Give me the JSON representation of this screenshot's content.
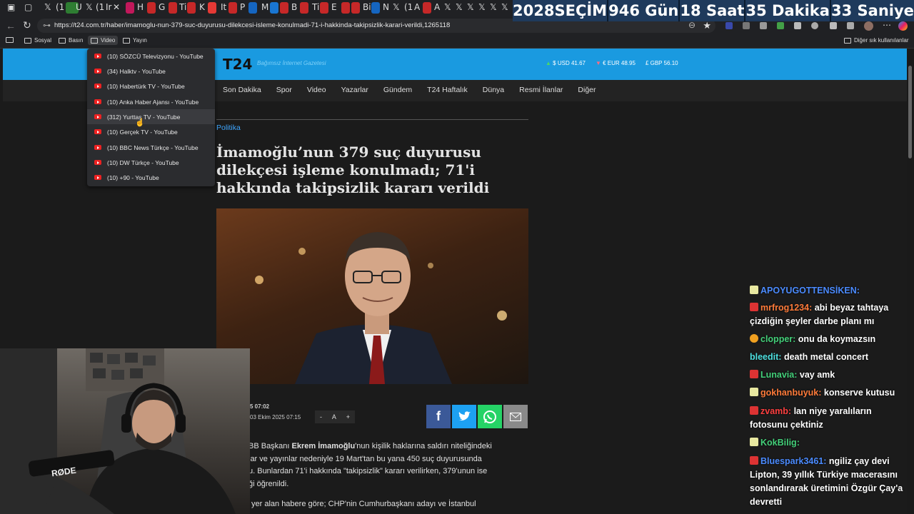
{
  "browser": {
    "url": "https://t24.com.tr/haber/imamoglu-nun-379-suc-duyurusu-dilekcesi-isleme-konulmadi-71-i-hakkinda-takipsizlik-karari-verildi,1265118",
    "tabs": [
      "(1",
      "Ir",
      "U",
      "(1",
      "H",
      "G",
      "Ti",
      "K",
      "It",
      "P",
      "M",
      "B",
      "Ti",
      "E",
      "Bi",
      "N",
      "(1",
      "A",
      "A",
      "X",
      "X"
    ],
    "countdown": [
      "2028",
      "SEÇİM",
      "946 Gün",
      "18 Saat",
      "35 Dakika",
      "33 Saniye"
    ],
    "bookmarks": [
      {
        "label": "Sosyal"
      },
      {
        "label": "Basın"
      },
      {
        "label": "Video"
      },
      {
        "label": "Yayın"
      }
    ],
    "other_bookmarks": "Diğer sık kullanılanlar"
  },
  "dropdown": {
    "items": [
      "(10) SÖZCÜ Televizyonu - YouTube",
      "(34) Halktv - YouTube",
      "(10) Habertürk TV - YouTube",
      "(10) Anka Haber Ajansı - YouTube",
      "(312) Yurttaş TV - YouTube",
      "(10) Gerçek TV - YouTube",
      "(10) BBC News Türkçe - YouTube",
      "(10) DW Türkçe - YouTube",
      "(10) +90 - YouTube"
    ]
  },
  "site": {
    "logo": "T24",
    "tagline": "Bağımsız İnternet Gazetesi",
    "currency": {
      "usd": "USD 41.67",
      "eur": "EUR 48.95",
      "gbp": "GBP 56.10"
    },
    "nav": [
      "Son Dakika",
      "Spor",
      "Video",
      "Yazarlar",
      "Gündem",
      "T24 Haftalık",
      "Dünya",
      "Resmi İlanlar",
      "Diğer"
    ]
  },
  "article": {
    "category": "Politika",
    "headline": "İmamoğlu’nun 379 suç duyurusu dilekçesi işleme konulmadı; 71'i hakkında takipsizlik kararı verildi",
    "date_published": "5 07:02",
    "date_updated": "03 Ekim 2025 07:15",
    "font_controls": [
      "-",
      "A",
      "+"
    ],
    "body_line1_pre": "BB Başkanı ",
    "body_line1_bold": "Ekrem İmamoğlu",
    "body_line1_post": "'nun kişilik haklarına saldırı niteliğindeki",
    "body_line2": "lar ve yayınlar nedeniyle 19 Mart'tan bu yana 450 suç duyurusunda",
    "body_line3": "u. Bunlardan 71'i hakkında \"takipsizlik\" kararı verilirken, 379'unun ise",
    "body_line4": "ği öğrenildi.",
    "body_line5": "yer alan habere göre; CHP'nin Cumhurbaşkanı adayı ve İstanbul"
  },
  "chat": [
    {
      "user": "APOYUGOTTENSİKEN:",
      "message": "",
      "color": "#4b8bff",
      "badge": "#e8e8a0"
    },
    {
      "user": "mrfrog1234:",
      "message": "abi beyaz tahtaya çizdiğin şeyler darbe planı mı",
      "color": "#ff7b3a",
      "badge": "#d33"
    },
    {
      "user": "clopper:",
      "message": "onu da koymazsın",
      "color": "#44d07a",
      "badge": "#f0a020"
    },
    {
      "user": "bleedit:",
      "message": "death metal concert",
      "color": "#4ee0e0",
      "badge": ""
    },
    {
      "user": "Lunavia:",
      "message": "vay amk",
      "color": "#44d07a",
      "badge": "#d33"
    },
    {
      "user": "gokhanbuyuk:",
      "message": "konserve kutusu",
      "color": "#ff7b3a",
      "badge": "#e8e8a0"
    },
    {
      "user": "zvamb:",
      "message": "lan niye yaralıların fotosunu çektiniz",
      "color": "#ff4040",
      "badge": "#d33"
    },
    {
      "user": "KokBilig:",
      "message": "",
      "color": "#44d07a",
      "badge": "#e8e8a0"
    },
    {
      "user": "Bluespark3461:",
      "message": "ngiliz çay devi Lipton, 39 yıllık Türkiye macerasını sonlandırarak üretimini Özgür Çay'a devretti",
      "color": "#4b8bff",
      "badge": "#d33"
    }
  ],
  "webcam": {
    "mic_brand": "RØDE"
  }
}
